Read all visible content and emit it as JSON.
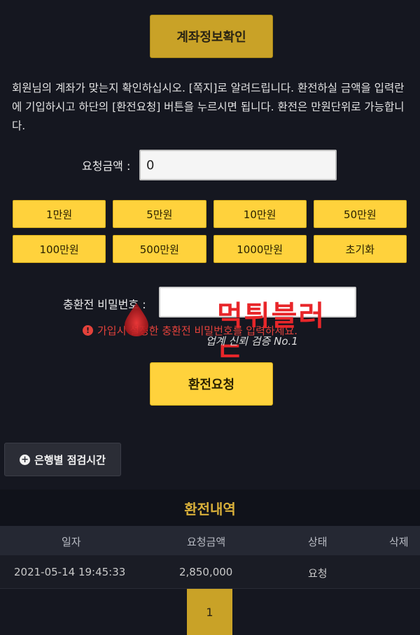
{
  "header": {
    "title_button": "계좌정보확인"
  },
  "notice": "회원님의 계좌가 맞는지 확인하십시오. [쪽지]로 알려드립니다. 환전하실 금액을 입력란에 기입하시고 하단의 [환전요청] 버튼을 누르시면 됩니다. 환전은 만원단위로 가능합니다.",
  "form": {
    "amount_label": "요청금액 :",
    "amount_value": "0",
    "amount_buttons": [
      "1만원",
      "5만원",
      "10만원",
      "50만원",
      "100만원",
      "500만원",
      "1000만원",
      "초기화"
    ],
    "password_label": "충환전 비밀번호 :",
    "password_value": "",
    "warning": "가입시 설정한 충환전 비밀번호를 입력하세요.",
    "submit_label": "환전요청"
  },
  "watermark": {
    "brand": "먹튀블러드",
    "sub": "업계 신뢰 검증 No.1"
  },
  "bank_button": {
    "label": "은행별 점검시간"
  },
  "history": {
    "title": "환전내역",
    "columns": [
      "일자",
      "요청금액",
      "상태",
      "삭제"
    ],
    "rows": [
      {
        "date": "2021-05-14 19:45:33",
        "amount": "2,850,000",
        "status": "요청",
        "delete": ""
      }
    ]
  },
  "pagination": {
    "current": "1"
  },
  "colors": {
    "gold": "#c9a227",
    "yellow": "#ffd23c",
    "background": "#151720",
    "warning": "#e3423b"
  }
}
